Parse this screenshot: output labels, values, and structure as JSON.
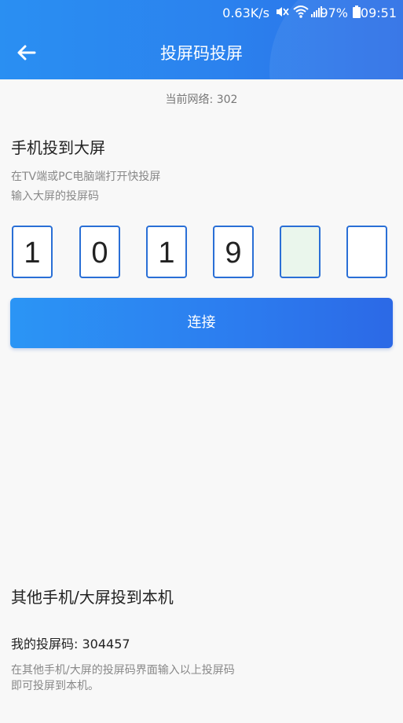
{
  "status_bar": {
    "speed": "0.63K/s",
    "battery": "97%",
    "time": "09:51",
    "icons": [
      "mute-icon",
      "wifi-icon",
      "signal-icon",
      "battery-icon"
    ]
  },
  "header": {
    "title": "投屏码投屏",
    "back_icon": "arrow-left-icon",
    "color": "#2b82ee"
  },
  "network": {
    "text": "当前网络: 302"
  },
  "cast_to_screen": {
    "title": "手机投到大屏",
    "desc_line1": "在TV端或PC电脑端打开快投屏",
    "desc_line2": "输入大屏的投屏码",
    "code_digits": [
      "1",
      "0",
      "1",
      "9",
      "",
      ""
    ],
    "active_index": 4,
    "connect_label": "连接"
  },
  "cast_to_device": {
    "title": "其他手机/大屏投到本机",
    "my_code_label": "我的投屏码: 304457",
    "hint_line1": "在其他手机/大屏的投屏码界面输入以上投屏码",
    "hint_line2": "即可投屏到本机。"
  }
}
